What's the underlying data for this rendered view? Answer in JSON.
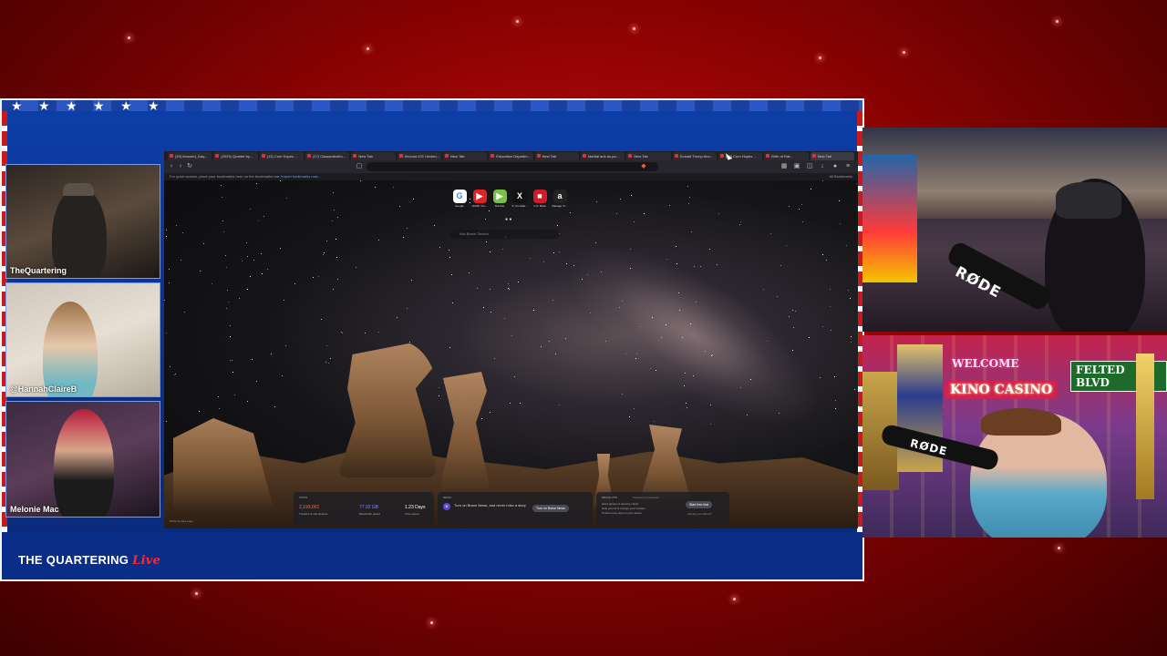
{
  "overlay": {
    "cam_labels": [
      "TheQuartering",
      "@HannahClaireB",
      "Melonie Mac"
    ],
    "logo_text": "THE QUARTERING",
    "logo_live": "Live",
    "neon_sign_welcome": "WELCOME",
    "neon_sign_casino": "KINO CASINO",
    "street_sign": "FELTED BLVD",
    "mic_brand": "RØDE"
  },
  "browser": {
    "tabs": [
      "(19) Amused_Gay...",
      "(2029) Quarter by...",
      "(13) Cum Hopes ...",
      "(17) CassandraHo...",
      "New Tab",
      "Second ICE Uniden...",
      "New Tab",
      "Education Departm...",
      "New Tab",
      "Martial arts as pa...",
      "New Tab",
      "Donald Trump Ann...",
      "(13) Cum Hopes ...",
      "Birth of Rat...",
      "New Tab"
    ],
    "active_tab_index": 14,
    "url": "",
    "bookmark_bar_text": "For quick access, place your bookmarks here on the bookmarks bar.",
    "bookmark_link": "Import bookmarks now...",
    "all_bookmarks": "All Bookmarks",
    "shortcuts": [
      {
        "label": "Google",
        "icon": "google-icon",
        "glyph": "G",
        "color": "#ffffff"
      },
      {
        "label": "(2029) You...",
        "icon": "youtube-icon",
        "glyph": "▶",
        "color": "#e02424"
      },
      {
        "label": "Rumble",
        "icon": "rumble-icon",
        "glyph": "▶",
        "color": "#79c046"
      },
      {
        "label": "X: It's what...",
        "icon": "x-icon",
        "glyph": "X",
        "color": "#000000"
      },
      {
        "label": "U.S. Bank",
        "icon": "bank-icon",
        "glyph": "■",
        "color": "#d01c2a"
      },
      {
        "label": "Manage Yo...",
        "icon": "amazon-icon",
        "glyph": "a",
        "color": "#222222"
      }
    ],
    "search_placeholder": "Ask Brave Search",
    "widgets": {
      "stats_title": "STATS",
      "stats_trackers": "2,193,001",
      "stats_trackers_label": "Trackers & ads blocked",
      "stats_bandwidth": "77.92 GB",
      "stats_bandwidth_label": "Bandwidth saved",
      "stats_time": "1.23 Days",
      "stats_time_label": "Time saved",
      "news_title": "NEWS",
      "news_text": "Turn on Brave News, and never miss a story",
      "news_button": "Turn on Brave News",
      "vpn_title": "BRAVE VPN",
      "vpn_badge": "Powered by Guardian",
      "vpn_points": [
        "Extra privacy & security online",
        "Hide your IP & change your location",
        "Protect every app on your device"
      ],
      "vpn_button": "Start free trial",
      "vpn_link": "Already purchased?"
    },
    "photo_credit": "Photo by Alex Lepe"
  }
}
